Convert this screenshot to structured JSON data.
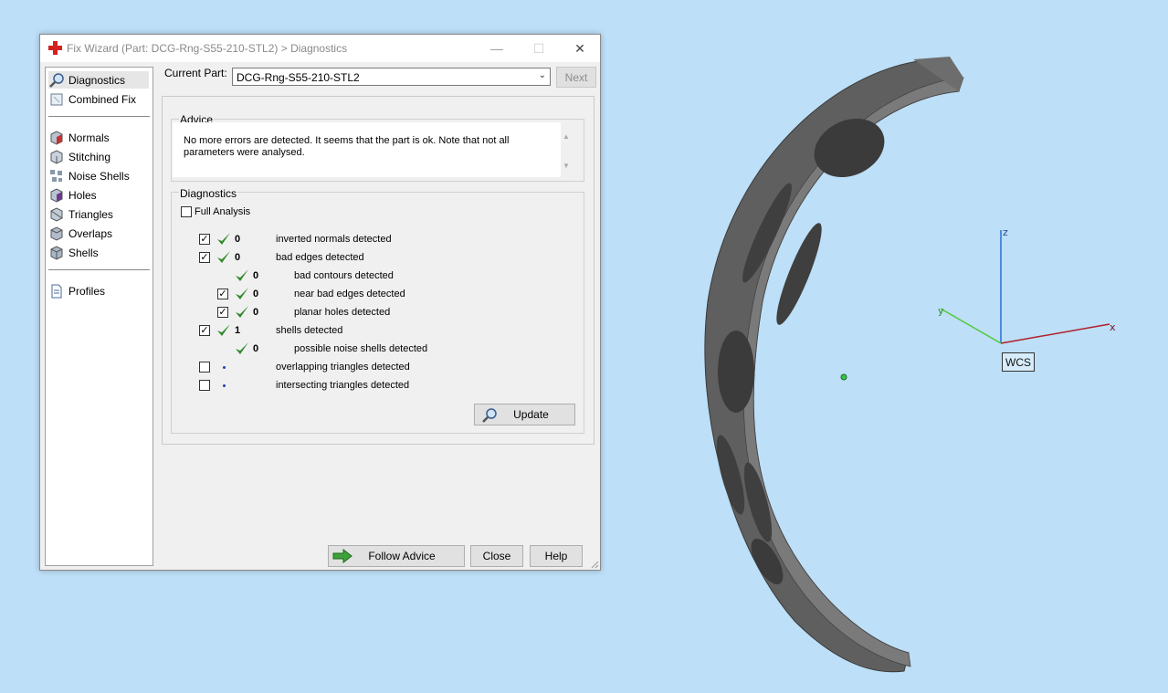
{
  "dialog": {
    "title": "Fix Wizard (Part: DCG-Rng-S55-210-STL2) > Diagnostics",
    "window_buttons": {
      "minimize": "—",
      "maximize": "☐",
      "close": "✕"
    }
  },
  "sidebar": {
    "items": [
      {
        "label": "Diagnostics",
        "icon": "magnifier-icon",
        "selected": true
      },
      {
        "label": "Combined Fix",
        "icon": "combined-fix-icon"
      },
      {
        "label": "Normals",
        "icon": "normals-cube-icon"
      },
      {
        "label": "Stitching",
        "icon": "stitching-cube-icon"
      },
      {
        "label": "Noise Shells",
        "icon": "noise-shells-icon"
      },
      {
        "label": "Holes",
        "icon": "holes-cube-icon"
      },
      {
        "label": "Triangles",
        "icon": "triangles-cube-icon"
      },
      {
        "label": "Overlaps",
        "icon": "overlaps-cube-icon"
      },
      {
        "label": "Shells",
        "icon": "shells-cube-icon"
      },
      {
        "label": "Profiles",
        "icon": "document-icon"
      }
    ]
  },
  "current_part": {
    "label": "Current Part:",
    "value": "DCG-Rng-S55-210-STL2",
    "next_label": "Next"
  },
  "advice": {
    "label": "Advice",
    "text": "No more errors are detected. It seems that the part is ok. Note that not all parameters were analysed."
  },
  "diagnostics": {
    "label": "Diagnostics",
    "full_analysis_label": "Full Analysis",
    "rows": [
      {
        "checkbox": true,
        "checked": true,
        "status": "ok",
        "count": "0",
        "text": "inverted normals detected",
        "indent": 0
      },
      {
        "checkbox": true,
        "checked": true,
        "status": "ok",
        "count": "0",
        "text": "bad edges detected",
        "indent": 0
      },
      {
        "checkbox": false,
        "checked": false,
        "status": "ok",
        "count": "0",
        "text": "bad contours detected",
        "indent": 1
      },
      {
        "checkbox": true,
        "checked": true,
        "status": "ok",
        "count": "0",
        "text": "near bad edges detected",
        "indent": 1
      },
      {
        "checkbox": true,
        "checked": true,
        "status": "ok",
        "count": "0",
        "text": "planar holes detected",
        "indent": 1
      },
      {
        "checkbox": true,
        "checked": true,
        "status": "ok",
        "count": "1",
        "text": "shells detected",
        "indent": 0
      },
      {
        "checkbox": false,
        "checked": false,
        "status": "ok",
        "count": "0",
        "text": "possible noise shells detected",
        "indent": 1
      },
      {
        "checkbox": true,
        "checked": false,
        "status": "none",
        "count": "",
        "text": "overlapping triangles detected",
        "indent": 0
      },
      {
        "checkbox": true,
        "checked": false,
        "status": "none",
        "count": "",
        "text": "intersecting triangles detected",
        "indent": 0
      }
    ],
    "update_label": "Update"
  },
  "footer": {
    "follow_advice_label": "Follow Advice",
    "close_label": "Close",
    "help_label": "Help"
  },
  "viewport": {
    "wcs_label": "WCS",
    "axis_x": "x",
    "axis_y": "y",
    "axis_z": "z",
    "colors": {
      "background": "#bddff7",
      "x_axis": "#b0202a",
      "y_axis": "#52c83a",
      "z_axis": "#2a6fd4",
      "part": "#5f5f5f"
    }
  }
}
